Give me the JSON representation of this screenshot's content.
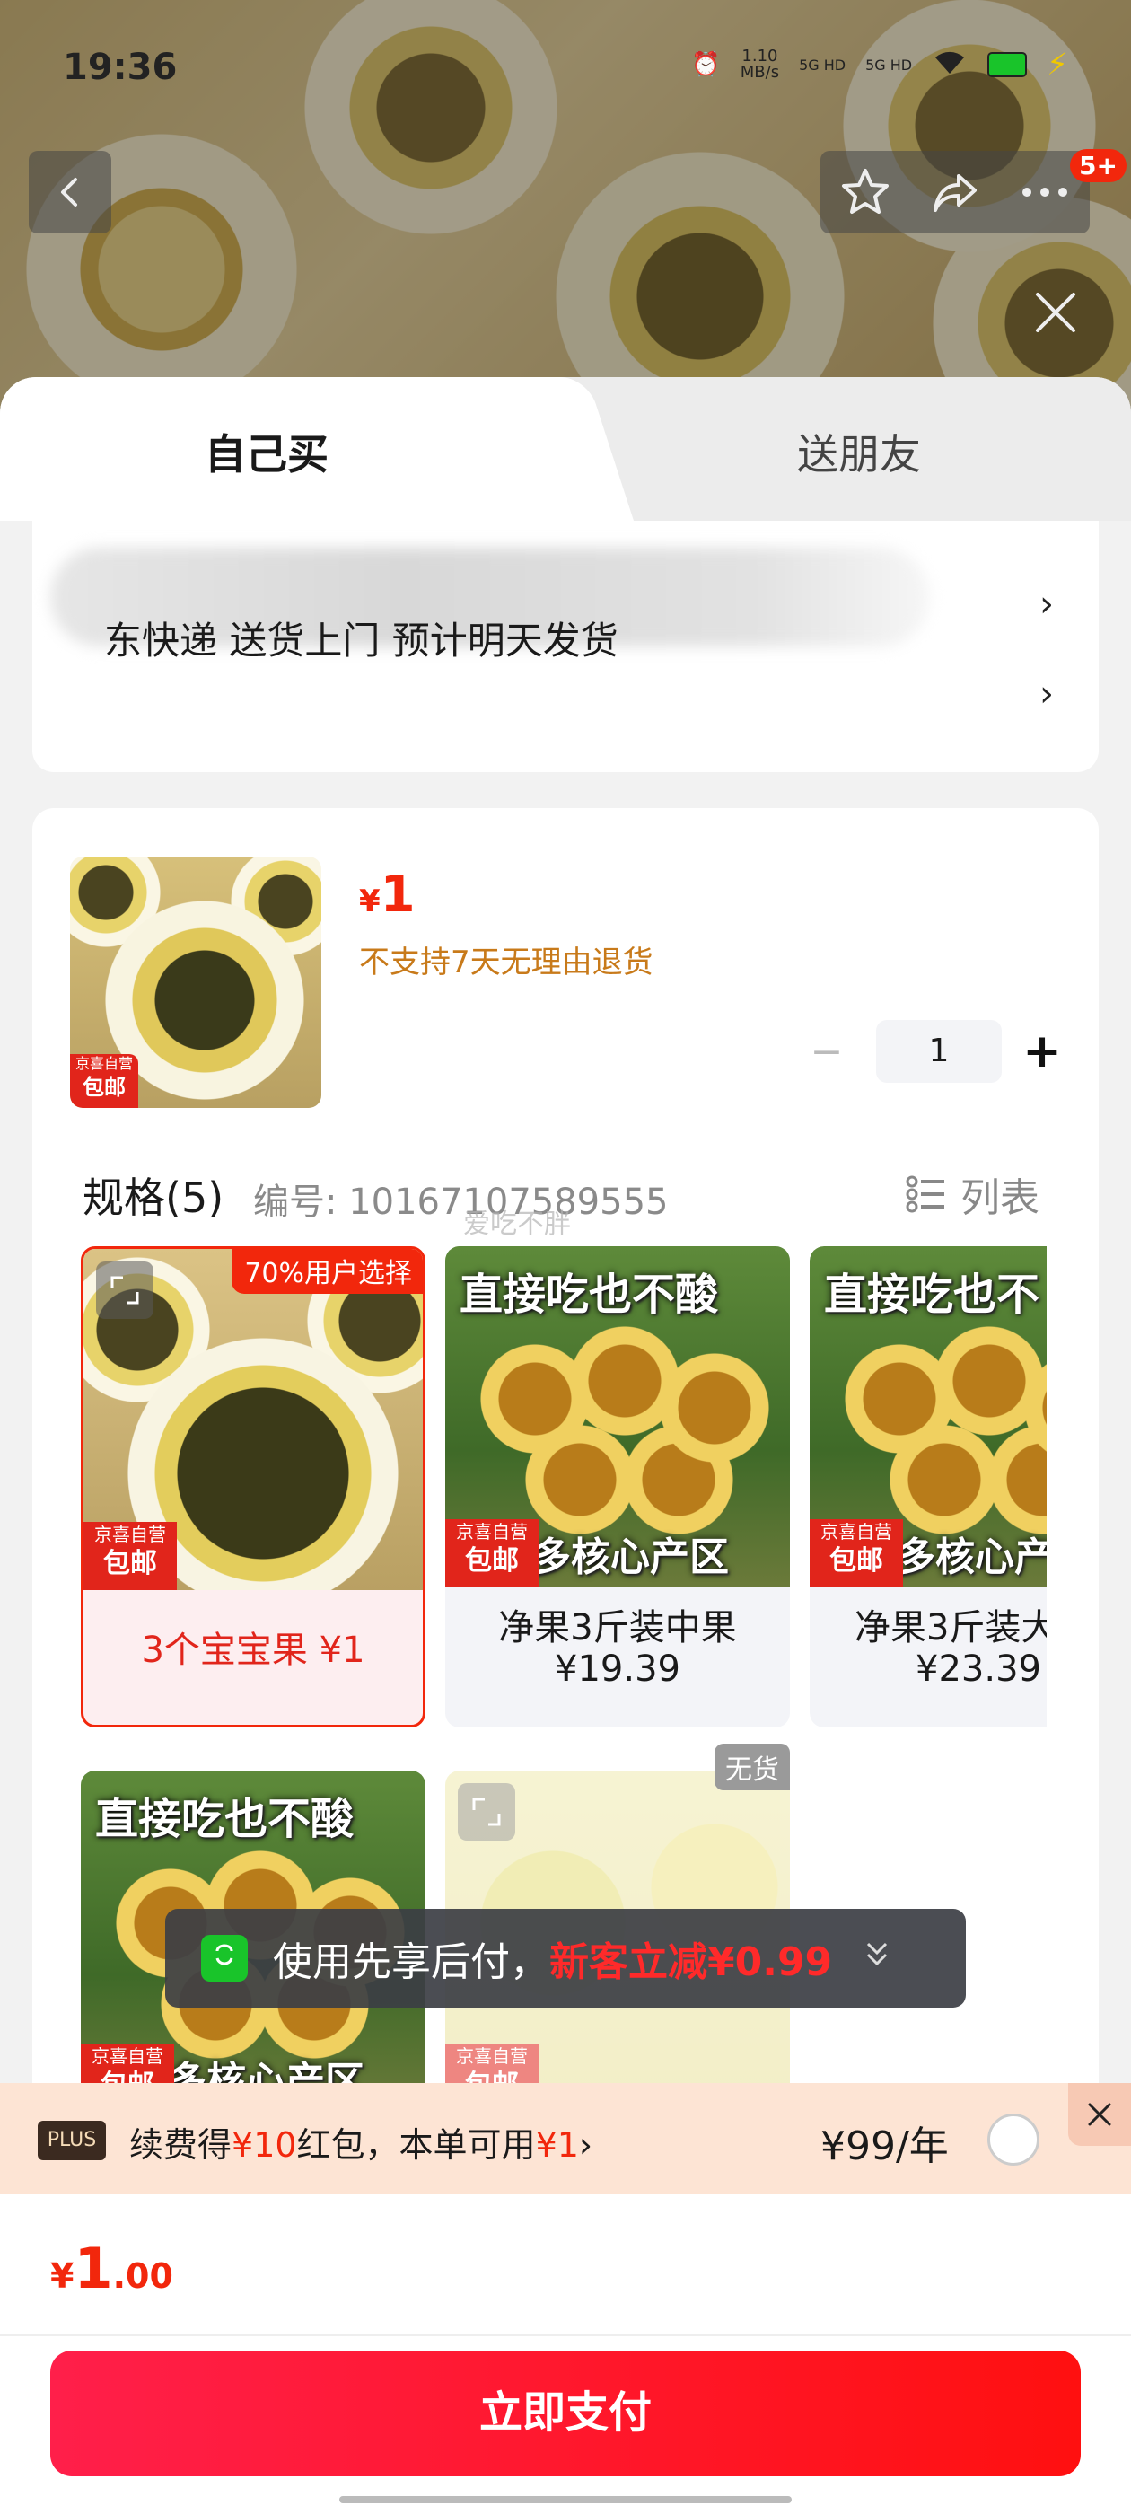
{
  "status_bar": {
    "time": "19:36",
    "net_speed_value": "1.10",
    "net_speed_unit": "MB/s",
    "signal_1": "5G HD",
    "signal_2": "5G HD"
  },
  "top_nav": {
    "more_badge": "5+",
    "icons": [
      "back-icon",
      "star-icon",
      "share-icon",
      "more-icon",
      "close-icon"
    ]
  },
  "tabs": {
    "self": "自己买",
    "gift": "送朋友"
  },
  "address": {
    "delivery_text": "东快递 送货上门 预计明天发货",
    "chevron": "›"
  },
  "product": {
    "thumb_tag_top": "京喜自营",
    "thumb_tag_bottom": "包邮",
    "price_currency": "¥",
    "price_value": "1",
    "return_policy": "不支持7天无理由退货",
    "quantity": "1",
    "minus": "−",
    "plus": "+"
  },
  "specs": {
    "title": "规格(5)",
    "code": "编号: 10167107589555",
    "watermark": "爱吃不胖",
    "list_toggle": "列表",
    "tiles": [
      {
        "badge": "70%用户选择",
        "line1": "3个宝宝果  ¥1",
        "line2": "",
        "tag_top": "京喜自营",
        "tag_bottom": "包邮",
        "caption_top": "",
        "caption_bottom": ""
      },
      {
        "badge": "",
        "line1": "净果3斤装中果",
        "line2": "¥19.39",
        "tag_top": "京喜自营",
        "tag_bottom": "包邮",
        "caption_top": "直接吃也不酸",
        "caption_bottom": "多核心产区"
      },
      {
        "badge": "",
        "line1": "净果3斤装大",
        "line2": "¥23.39",
        "tag_top": "京喜自营",
        "tag_bottom": "包邮",
        "caption_top": "直接吃也不",
        "caption_bottom": "多核心产"
      },
      {
        "badge": "",
        "line1": "",
        "line2": "",
        "tag_top": "京喜自营",
        "tag_bottom": "包邮",
        "caption_top": "直接吃也不酸",
        "caption_bottom": "多核心产区"
      },
      {
        "badge": "无货",
        "line1": "",
        "line2": "",
        "tag_top": "京喜自营",
        "tag_bottom": "包邮",
        "caption_top": "",
        "caption_bottom": ""
      }
    ]
  },
  "toast": {
    "text": "使用先享后付，",
    "highlight": "新客立减¥0.99"
  },
  "plus_bar": {
    "tag": "PLUS",
    "text_1": "续费得",
    "red_1": "¥10",
    "text_2": "红包，本单可用",
    "red_2": "¥1",
    "arrow": "›",
    "price": "¥99/年"
  },
  "footer": {
    "currency": "¥",
    "price_int": "1",
    "price_dec": ".00",
    "pay_label": "立即支付"
  },
  "colors": {
    "accent": "#f2270c",
    "pay_gradient_start": "#ff1f4a",
    "pay_gradient_end": "#ff1010",
    "plus_bar_bg": "#fde4d4",
    "warning_text": "#c87a1a"
  }
}
